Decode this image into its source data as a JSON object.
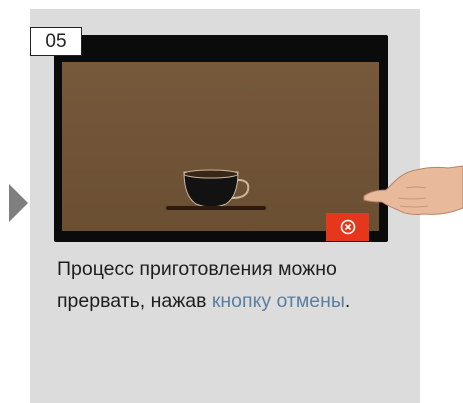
{
  "step": {
    "number": "05"
  },
  "screen": {
    "cup_icon": "coffee-cup-icon",
    "cancel_button": {
      "icon": "cancel-x-icon",
      "color": "#e5371c"
    }
  },
  "caption": {
    "text_before": "Процесс приготовления можно прервать, нажав ",
    "link_text": "кнопку отмены",
    "text_after": "."
  },
  "colors": {
    "panel": "#dcdcdc",
    "display": "#76593b",
    "link": "#5c7fa0",
    "arrow": "#7f7f7f"
  }
}
